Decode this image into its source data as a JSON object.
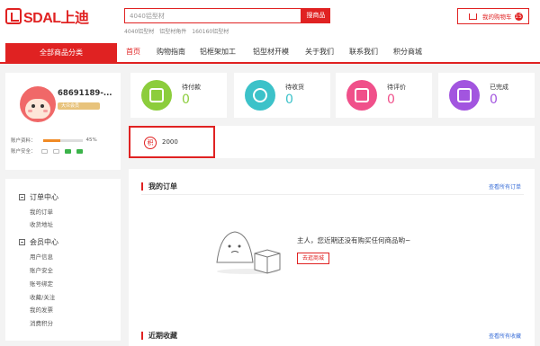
{
  "header": {
    "logo_text": "SDAL上迪",
    "search_placeholder": "4040铝型材",
    "search_button": "搜商品",
    "hotwords": [
      "4040铝型材",
      "铝型材角件",
      "160160铝型材"
    ],
    "cart_label": "我的购物车",
    "cart_count": "15"
  },
  "nav": {
    "all_categories": "全部商品分类",
    "items": [
      "首页",
      "购物指南",
      "铝框架加工",
      "铝型材开模",
      "关于我们",
      "联系我们",
      "积分商城"
    ]
  },
  "profile": {
    "username": "68691189-...",
    "level": "大众会员",
    "account_info_label": "账户资料：",
    "account_progress": "45%",
    "account_security_label": "账户安全："
  },
  "menu": {
    "order_center": "订单中心",
    "order_links": [
      "我的订单",
      "收货地址"
    ],
    "member_center": "会员中心",
    "member_links": [
      "用户信息",
      "账户安全",
      "账号绑定",
      "收藏/关注",
      "我的发票",
      "消费积分"
    ]
  },
  "status_cards": [
    {
      "label": "待付款",
      "value": "0",
      "color": "#8ccd3c",
      "icon": "wallet-icon"
    },
    {
      "label": "待收货",
      "value": "0",
      "color": "#3cc2c9",
      "icon": "truck-icon"
    },
    {
      "label": "待评价",
      "value": "0",
      "color": "#f0508a",
      "icon": "pencil-icon"
    },
    {
      "label": "已完成",
      "value": "0",
      "color": "#a255df",
      "icon": "check-bag-icon"
    }
  ],
  "points": {
    "icon_text": "积",
    "value": "2000"
  },
  "orders": {
    "title": "我的订单",
    "view_all": "查看所有订单",
    "empty_text": "主人，您近期还没有购买任何商品哟~",
    "go_button": "去逛商城"
  },
  "collections": {
    "title": "近期收藏",
    "view_all": "查看所有收藏"
  },
  "colors": {
    "accent": "#e02222"
  }
}
